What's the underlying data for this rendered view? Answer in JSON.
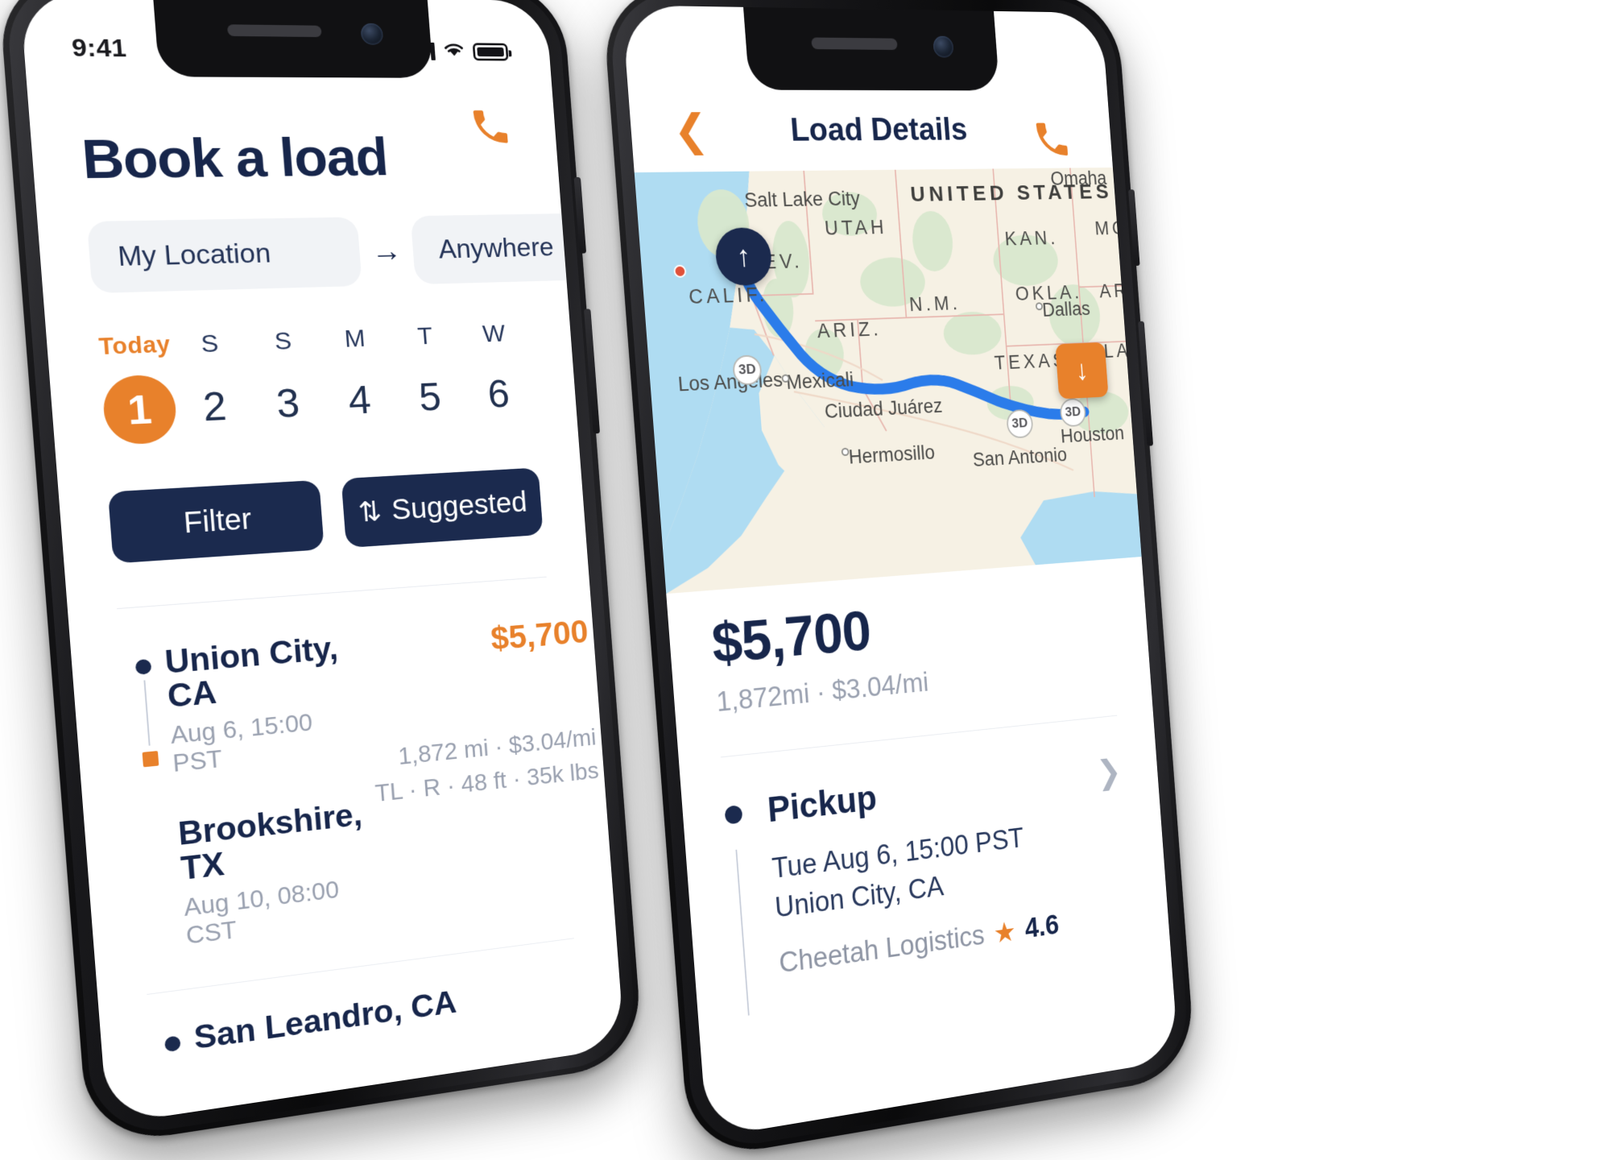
{
  "left_phone": {
    "status_bar": {
      "time": "9:41",
      "signal_icon": "signal-bars-icon",
      "wifi_icon": "wifi-icon",
      "battery_icon": "battery-icon"
    },
    "call_icon": "phone-call-icon",
    "title": "Book a load",
    "route": {
      "from": "My Location",
      "to": "Anywhere",
      "arrow_icon": "arrow-right-icon"
    },
    "calendar": {
      "today_label": "Today",
      "days": [
        {
          "dow": "Today",
          "num": "1",
          "selected": true
        },
        {
          "dow": "S",
          "num": "2",
          "selected": false
        },
        {
          "dow": "S",
          "num": "3",
          "selected": false
        },
        {
          "dow": "M",
          "num": "4",
          "selected": false
        },
        {
          "dow": "T",
          "num": "5",
          "selected": false
        },
        {
          "dow": "W",
          "num": "6",
          "selected": false
        }
      ]
    },
    "buttons": {
      "filter": "Filter",
      "sort": "Suggested",
      "sort_icon": "sort-updown-icon"
    },
    "loads": [
      {
        "origin_city": "Union City, CA",
        "origin_time": "Aug 6, 15:00 PST",
        "dest_city": "Brookshire, TX",
        "dest_time": "Aug 10, 08:00 CST",
        "price": "$5,700",
        "distance": "1,872 mi · $3.04/mi",
        "specs": "TL · R · 48 ft · 35k lbs"
      },
      {
        "origin_city": "San Leandro, CA",
        "origin_time": "",
        "dest_city": "",
        "dest_time": "",
        "price": "",
        "distance": "",
        "specs": ""
      }
    ]
  },
  "right_phone": {
    "status_bar": {
      "time": "",
      "signal_icon": "signal-bars-icon",
      "wifi_icon": "wifi-icon",
      "battery_icon": "battery-icon"
    },
    "call_icon": "phone-call-icon",
    "nav": {
      "back_icon": "chevron-left-icon",
      "title": "Load Details"
    },
    "map": {
      "country_label": "UNITED STATES",
      "states": [
        "UTAH",
        "NEV.",
        "KAN.",
        "N.M.",
        "ARIZ.",
        "OKLA.",
        "TEXAS",
        "MO",
        "AR",
        "LA",
        "CALIF."
      ],
      "cities": [
        "Salt Lake City",
        "Omaha",
        "Los Angeles",
        "Mexicali",
        "Ciudad Juárez",
        "Hermosillo",
        "San Antonio",
        "Dallas",
        "Houston"
      ],
      "pickup_marker_icon": "arrow-up-marker",
      "dropoff_marker_icon": "arrow-down-marker",
      "zoom_badges": [
        "3D",
        "3D",
        "3D"
      ],
      "route_color": "#2B7CEA"
    },
    "price": {
      "amount": "$5,700",
      "detail": "1,872mi · $3.04/mi"
    },
    "pickup": {
      "title": "Pickup",
      "chevron_icon": "chevron-right-icon",
      "datetime": "Tue Aug 6, 15:00 PST",
      "location": "Union City, CA",
      "carrier": "Cheetah Logistics",
      "star_icon": "star-icon",
      "rating": "4.6"
    }
  },
  "colors": {
    "navy": "#17264B",
    "orange": "#E8812B",
    "route_blue": "#2B7CEA",
    "muted": "#9AA1B0",
    "pill_bg": "#F1F3F6"
  }
}
